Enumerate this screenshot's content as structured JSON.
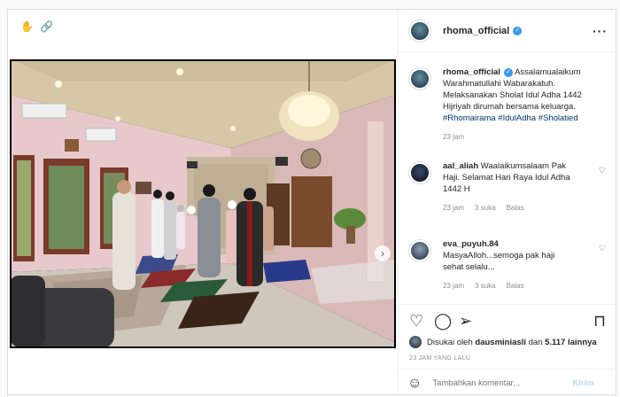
{
  "toolbar": {
    "icons": [
      "hand-icon",
      "link-icon"
    ]
  },
  "post": {
    "author": "rhoma_official",
    "verified": true,
    "menu_icon": "more-options-icon",
    "caption_lines": [
      "Assalamualaikum",
      "Warahmatullahi Wabarakatuh.",
      "Melaksanakan Sholat Idul Adha 1442",
      "Hijriyah dirumah bersama keluarga."
    ],
    "hashtags": "#Rhomairama #IdulAdha #Sholatied",
    "caption_time": "23 jam"
  },
  "comments": [
    {
      "user": "aal_aliah",
      "lines": [
        "Waalaikumsalaam Pak",
        "Haji. Selamat Hari Raya Idul Adha",
        "1442 H"
      ],
      "time": "23 jam",
      "likes": "3 suka",
      "reply": "Balas"
    },
    {
      "user": "eva_puyuh.84",
      "lines": [
        "MasyaAlloh...semoga pak haji",
        "sehat selalu..."
      ],
      "time": "23 jam",
      "likes": "3 suka",
      "reply": "Balas"
    }
  ],
  "actions": {
    "icons": [
      "heart-icon",
      "comment-icon",
      "share-icon",
      "bookmark-icon"
    ]
  },
  "likes": {
    "prefix": "Disukai oleh",
    "user": "dausminiasli",
    "joiner": "dan",
    "count": "5.117 lainnya"
  },
  "timestamp": "23 JAM YANG LALU",
  "comment_input": {
    "placeholder": "Tambahkan komentar...",
    "post_label": "Kirim"
  },
  "colors": {
    "link": "#00376b",
    "verified": "#3897f0",
    "muted": "#8e8e8e"
  }
}
